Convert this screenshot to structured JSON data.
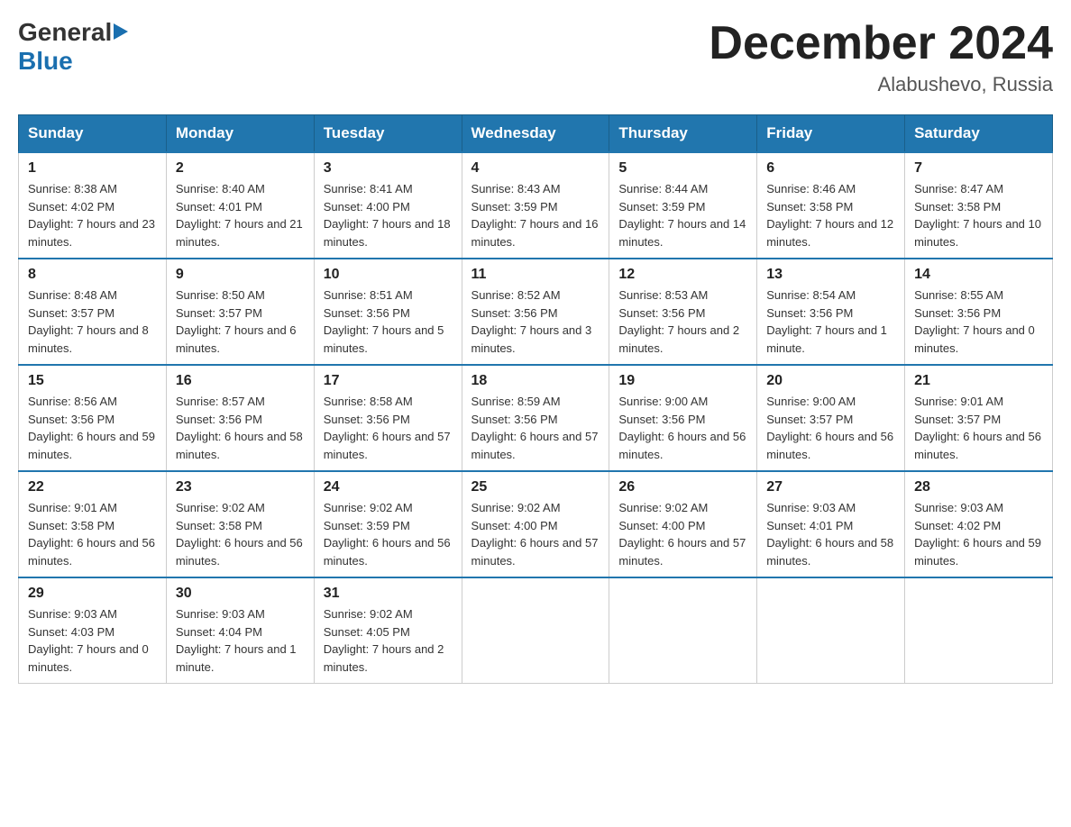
{
  "header": {
    "logo_general": "General",
    "logo_blue": "Blue",
    "month_year": "December 2024",
    "location": "Alabushevo, Russia"
  },
  "days_of_week": [
    "Sunday",
    "Monday",
    "Tuesday",
    "Wednesday",
    "Thursday",
    "Friday",
    "Saturday"
  ],
  "weeks": [
    [
      {
        "day": "1",
        "sunrise": "8:38 AM",
        "sunset": "4:02 PM",
        "daylight": "7 hours and 23 minutes."
      },
      {
        "day": "2",
        "sunrise": "8:40 AM",
        "sunset": "4:01 PM",
        "daylight": "7 hours and 21 minutes."
      },
      {
        "day": "3",
        "sunrise": "8:41 AM",
        "sunset": "4:00 PM",
        "daylight": "7 hours and 18 minutes."
      },
      {
        "day": "4",
        "sunrise": "8:43 AM",
        "sunset": "3:59 PM",
        "daylight": "7 hours and 16 minutes."
      },
      {
        "day": "5",
        "sunrise": "8:44 AM",
        "sunset": "3:59 PM",
        "daylight": "7 hours and 14 minutes."
      },
      {
        "day": "6",
        "sunrise": "8:46 AM",
        "sunset": "3:58 PM",
        "daylight": "7 hours and 12 minutes."
      },
      {
        "day": "7",
        "sunrise": "8:47 AM",
        "sunset": "3:58 PM",
        "daylight": "7 hours and 10 minutes."
      }
    ],
    [
      {
        "day": "8",
        "sunrise": "8:48 AM",
        "sunset": "3:57 PM",
        "daylight": "7 hours and 8 minutes."
      },
      {
        "day": "9",
        "sunrise": "8:50 AM",
        "sunset": "3:57 PM",
        "daylight": "7 hours and 6 minutes."
      },
      {
        "day": "10",
        "sunrise": "8:51 AM",
        "sunset": "3:56 PM",
        "daylight": "7 hours and 5 minutes."
      },
      {
        "day": "11",
        "sunrise": "8:52 AM",
        "sunset": "3:56 PM",
        "daylight": "7 hours and 3 minutes."
      },
      {
        "day": "12",
        "sunrise": "8:53 AM",
        "sunset": "3:56 PM",
        "daylight": "7 hours and 2 minutes."
      },
      {
        "day": "13",
        "sunrise": "8:54 AM",
        "sunset": "3:56 PM",
        "daylight": "7 hours and 1 minute."
      },
      {
        "day": "14",
        "sunrise": "8:55 AM",
        "sunset": "3:56 PM",
        "daylight": "7 hours and 0 minutes."
      }
    ],
    [
      {
        "day": "15",
        "sunrise": "8:56 AM",
        "sunset": "3:56 PM",
        "daylight": "6 hours and 59 minutes."
      },
      {
        "day": "16",
        "sunrise": "8:57 AM",
        "sunset": "3:56 PM",
        "daylight": "6 hours and 58 minutes."
      },
      {
        "day": "17",
        "sunrise": "8:58 AM",
        "sunset": "3:56 PM",
        "daylight": "6 hours and 57 minutes."
      },
      {
        "day": "18",
        "sunrise": "8:59 AM",
        "sunset": "3:56 PM",
        "daylight": "6 hours and 57 minutes."
      },
      {
        "day": "19",
        "sunrise": "9:00 AM",
        "sunset": "3:56 PM",
        "daylight": "6 hours and 56 minutes."
      },
      {
        "day": "20",
        "sunrise": "9:00 AM",
        "sunset": "3:57 PM",
        "daylight": "6 hours and 56 minutes."
      },
      {
        "day": "21",
        "sunrise": "9:01 AM",
        "sunset": "3:57 PM",
        "daylight": "6 hours and 56 minutes."
      }
    ],
    [
      {
        "day": "22",
        "sunrise": "9:01 AM",
        "sunset": "3:58 PM",
        "daylight": "6 hours and 56 minutes."
      },
      {
        "day": "23",
        "sunrise": "9:02 AM",
        "sunset": "3:58 PM",
        "daylight": "6 hours and 56 minutes."
      },
      {
        "day": "24",
        "sunrise": "9:02 AM",
        "sunset": "3:59 PM",
        "daylight": "6 hours and 56 minutes."
      },
      {
        "day": "25",
        "sunrise": "9:02 AM",
        "sunset": "4:00 PM",
        "daylight": "6 hours and 57 minutes."
      },
      {
        "day": "26",
        "sunrise": "9:02 AM",
        "sunset": "4:00 PM",
        "daylight": "6 hours and 57 minutes."
      },
      {
        "day": "27",
        "sunrise": "9:03 AM",
        "sunset": "4:01 PM",
        "daylight": "6 hours and 58 minutes."
      },
      {
        "day": "28",
        "sunrise": "9:03 AM",
        "sunset": "4:02 PM",
        "daylight": "6 hours and 59 minutes."
      }
    ],
    [
      {
        "day": "29",
        "sunrise": "9:03 AM",
        "sunset": "4:03 PM",
        "daylight": "7 hours and 0 minutes."
      },
      {
        "day": "30",
        "sunrise": "9:03 AM",
        "sunset": "4:04 PM",
        "daylight": "7 hours and 1 minute."
      },
      {
        "day": "31",
        "sunrise": "9:02 AM",
        "sunset": "4:05 PM",
        "daylight": "7 hours and 2 minutes."
      },
      null,
      null,
      null,
      null
    ]
  ]
}
